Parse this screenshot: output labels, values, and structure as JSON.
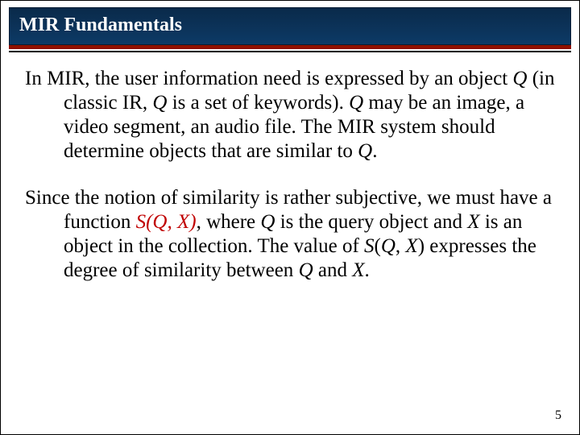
{
  "title": "MIR Fundamentals",
  "para1": {
    "t0": "In MIR, the user information need is expressed by an object ",
    "q1": "Q",
    "t1": " (in classic IR, ",
    "q2": "Q",
    "t2": " is a set of keywords). ",
    "q3": "Q",
    "t3": " may be an image, a video segment, an audio file. The MIR system should determine objects that are similar to ",
    "q4": "Q",
    "t4": "."
  },
  "para2": {
    "t0": "Since the notion of similarity is rather subjective, we must have a function ",
    "s1": "S",
    "p1": "(",
    "sq1": "Q",
    "c1": ", ",
    "sx1": "X",
    "p2": ")",
    "t1": ", where ",
    "q1": "Q",
    "t2": " is the query object and ",
    "x1": "X",
    "t3": " is an object in the collection. The value of ",
    "s2": "S",
    "p3": "(",
    "sq2": "Q",
    "c2": ", ",
    "sx2": "X",
    "p4": ")",
    "t4": " expresses the degree of similarity between ",
    "q2": "Q",
    "t5": " and ",
    "x2": "X",
    "t6": "."
  },
  "page_number": "5"
}
